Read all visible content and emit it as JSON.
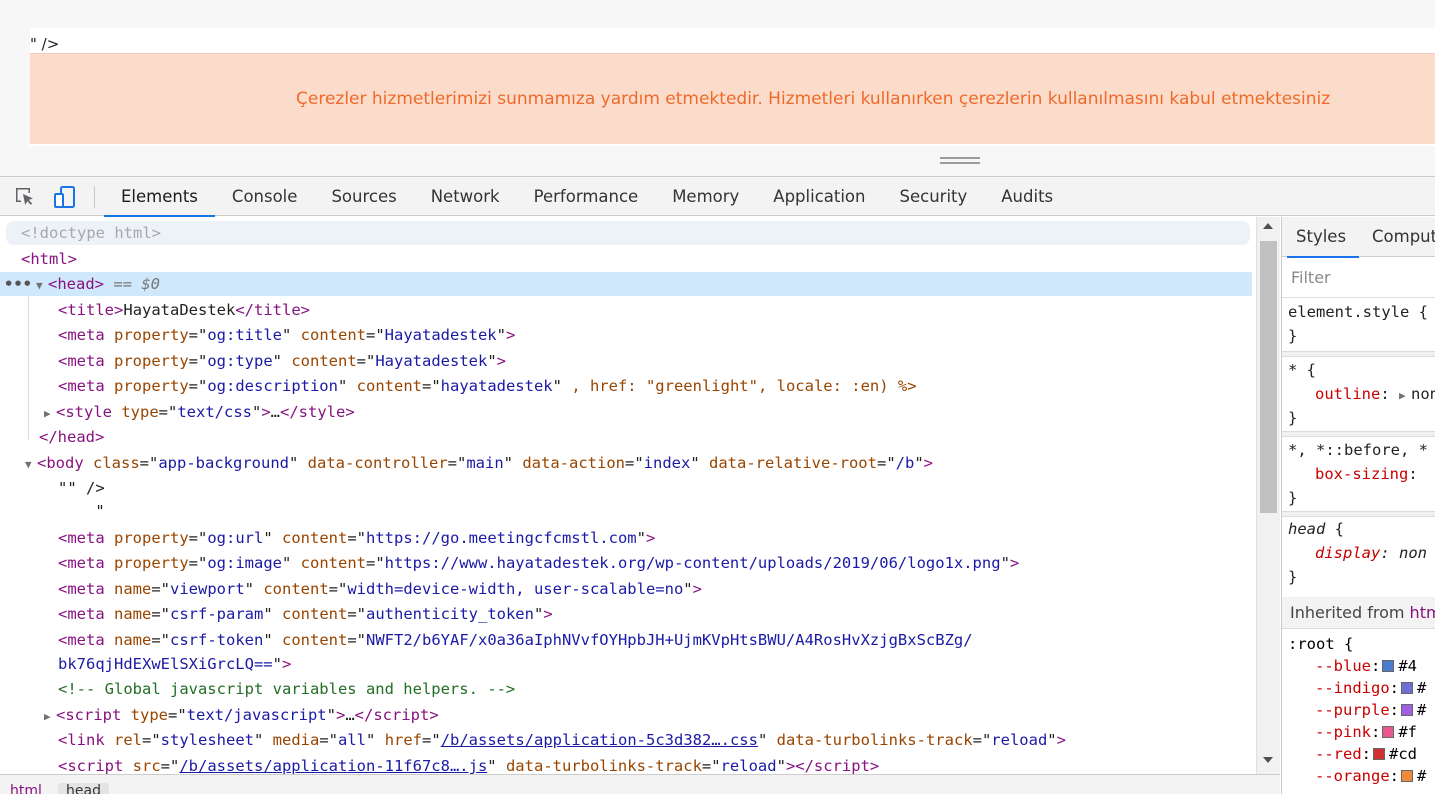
{
  "page": {
    "stray_text": "\" />",
    "cookie_text": "Çerezler hizmetlerimizi sunmamıza yardım etmektedir. Hizmetleri kullanırken çerezlerin kullanılmasını kabul etmektesiniz"
  },
  "devtools": {
    "tabs": [
      "Elements",
      "Console",
      "Sources",
      "Network",
      "Performance",
      "Memory",
      "Application",
      "Security",
      "Audits"
    ],
    "active_tab": "Elements",
    "icons": [
      "inspect-element-icon",
      "device-toolbar-icon"
    ]
  },
  "dom": {
    "doctype": "<!doctype html>",
    "html_open": "<html>",
    "head_open": "<head>",
    "selected_marker": " == $0",
    "ellipsis": "•••",
    "title_tag": "title",
    "title_text": "HayataDestek",
    "meta_og_title": {
      "property": "og:title",
      "content": "Hayatadestek"
    },
    "meta_og_type": {
      "property": "og:type",
      "content": "Hayatadestek"
    },
    "meta_og_description": {
      "property": "og:description",
      "content": "hayatadestek",
      "trailing": " , href: \"greenlight\", locale: :en) %>"
    },
    "style_type": "text/css",
    "head_close": "</head>",
    "body": {
      "class": "app-background",
      "data_controller": "main",
      "data_action": "index",
      "data_relative_root": "/b"
    },
    "text_node_1": "\"\" />",
    "text_node_2": "    \"",
    "meta_og_url": {
      "property": "og:url",
      "content": "https://go.meetingcfcmstl.com"
    },
    "meta_og_image": {
      "property": "og:image",
      "content": "https://www.hayatadestek.org/wp-content/uploads/2019/06/logo1x.png"
    },
    "meta_viewport": {
      "name": "viewport",
      "content": "width=device-width, user-scalable=no"
    },
    "meta_csrf_param": {
      "name": "csrf-param",
      "content": "authenticity_token"
    },
    "meta_csrf_token": {
      "name": "csrf-token",
      "content_line1": "NWFT2/b6YAF/x0a36aIphNVvfOYHpbJH+UjmKVpHtsBWU/A4RosHvXzjgBxScBZg/",
      "content_line2": "bk76qjHdEXwElSXiGrcLQ=="
    },
    "comment": "<!-- Global javascript variables and helpers. -->",
    "script_type": "text/javascript",
    "link_stylesheet": {
      "rel": "stylesheet",
      "media": "all",
      "href": "/b/assets/application-5c3d382….css",
      "track": "reload"
    },
    "script_src": {
      "src": "/b/assets/application-11f67c8….js",
      "track": "reload"
    }
  },
  "breadcrumb": [
    "html",
    "head"
  ],
  "styles": {
    "tabs": [
      "Styles",
      "Comput"
    ],
    "filter_placeholder": "Filter",
    "element_style": "element.style {",
    "universal_selector": "* {",
    "outline_prop": "outline",
    "outline_val": "non",
    "boxsizing_selector": "*, *::before, *",
    "boxsizing_prop": "box-sizing",
    "head_selector": "head",
    "display_prop": "display",
    "display_val": "non",
    "inherited_label": "Inherited from ",
    "inherited_link": "htm",
    "root_selector": ":root",
    "vars": [
      {
        "name": "--blue",
        "color": "#4a7bd0",
        "value": "#4"
      },
      {
        "name": "--indigo",
        "color": "#6f6fd6",
        "value": "#"
      },
      {
        "name": "--purple",
        "color": "#a05fe0",
        "value": "#"
      },
      {
        "name": "--pink",
        "color": "#e85a8f",
        "value": "#f"
      },
      {
        "name": "--red",
        "color": "#d03030",
        "value": "#cd"
      },
      {
        "name": "--orange",
        "color": "#f08a3c",
        "value": "#"
      }
    ]
  }
}
